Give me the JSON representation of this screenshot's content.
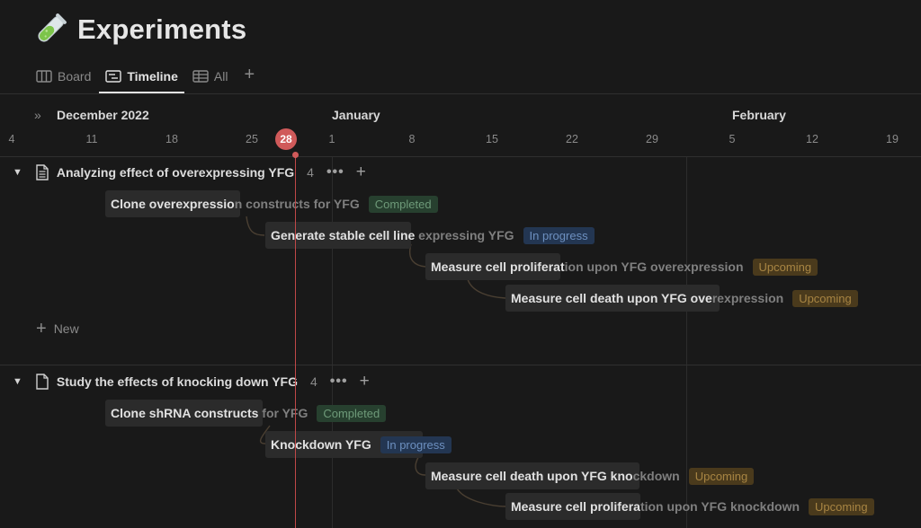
{
  "page": {
    "title": "Experiments",
    "icon": "test-tube-icon"
  },
  "tabs": [
    {
      "label": "Board",
      "icon": "board-icon",
      "active": false
    },
    {
      "label": "Timeline",
      "icon": "timeline-icon",
      "active": true
    },
    {
      "label": "All",
      "icon": "table-icon",
      "active": false
    }
  ],
  "timeline": {
    "months": {
      "december": "December 2022",
      "january": "January",
      "february": "February"
    },
    "days": [
      "4",
      "11",
      "18",
      "25",
      "1",
      "8",
      "15",
      "22",
      "29",
      "5",
      "12",
      "19"
    ],
    "today": "28"
  },
  "groups": [
    {
      "title": "Analyzing effect of overexpressing YFG",
      "count": "4",
      "tasks": [
        {
          "name_a": "Clone overexpressio",
          "name_b": "n constructs for YFG",
          "status": "Completed"
        },
        {
          "name_a": "Generate stable cell line",
          "name_b": " expressing YFG",
          "status": "In progress"
        },
        {
          "name_a": "Measure cell proliferat",
          "name_b": "ion upon YFG overexpression",
          "status": "Upcoming"
        },
        {
          "name_a": "Measure cell death upon YFG ove",
          "name_b": "rexpression",
          "status": "Upcoming"
        }
      ],
      "new_label": "New"
    },
    {
      "title": "Study the effects of knocking down YFG",
      "count": "4",
      "tasks": [
        {
          "name_a": "Clone shRNA constructs",
          "name_b": " for YFG",
          "status": "Completed"
        },
        {
          "name_a": "Knockdown YFG",
          "name_b": "",
          "status": "In progress"
        },
        {
          "name_a": "Measure cell death upon YFG kno",
          "name_b": "ckdown",
          "status": "Upcoming"
        },
        {
          "name_a": "Measure cell prolifera",
          "name_b": "tion upon YFG knockdown",
          "status": "Upcoming"
        }
      ]
    }
  ],
  "colors": {
    "today": "#d05a5a",
    "completed": "#6e9a79",
    "in_progress": "#6d90c0",
    "upcoming": "#a88543"
  }
}
